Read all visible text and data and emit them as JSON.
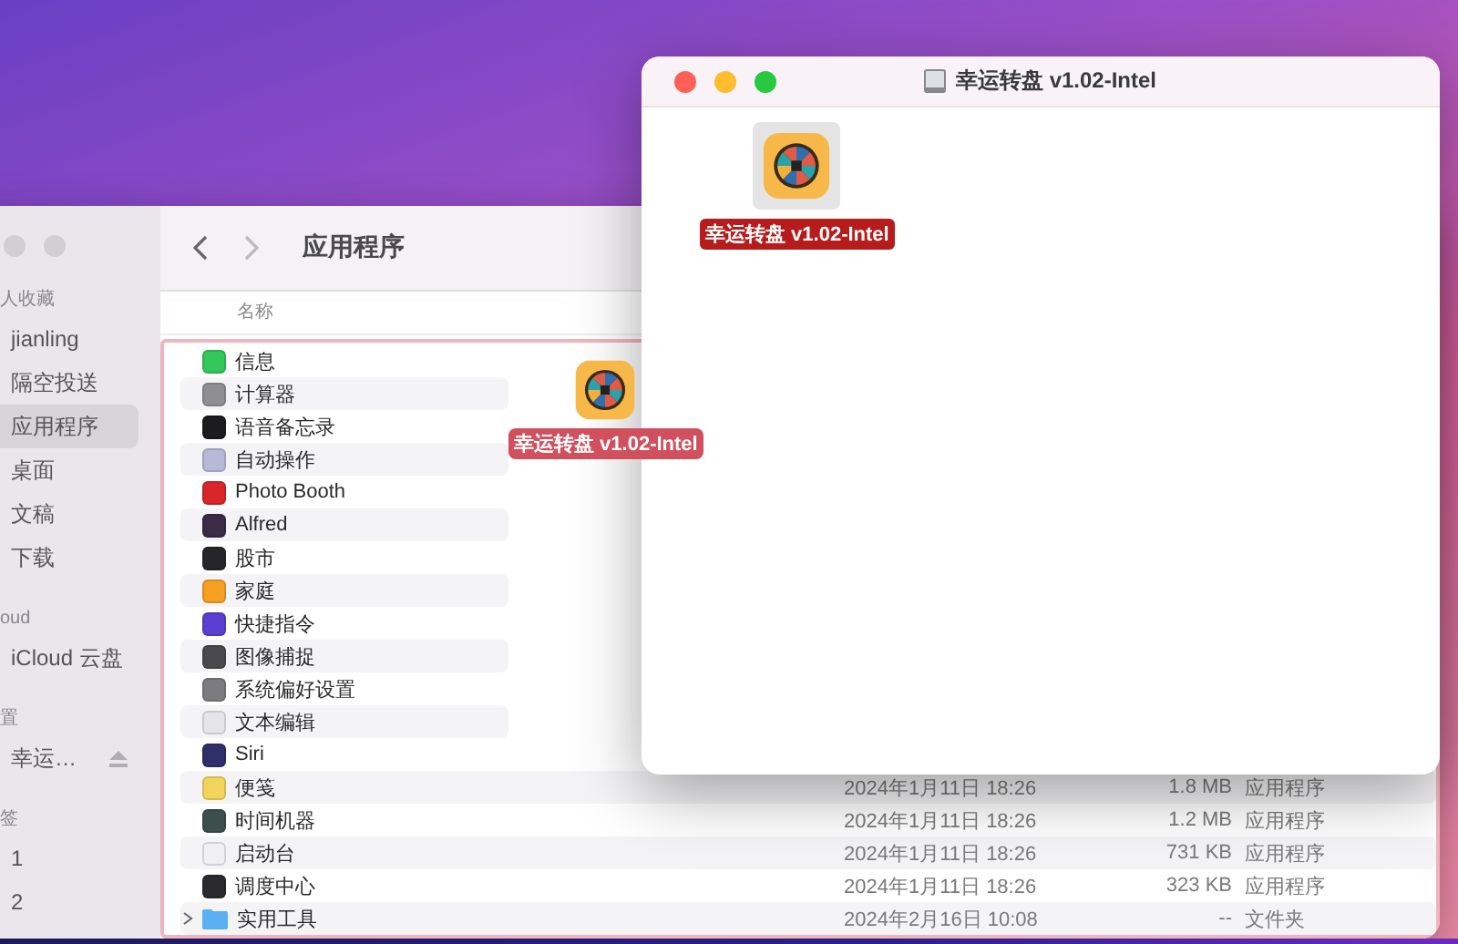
{
  "finder": {
    "title": "应用程序",
    "column_header": "名称",
    "sidebar": [
      {
        "heading": "人收藏",
        "items": [
          {
            "label": "jianling",
            "selected": false
          },
          {
            "label": "隔空投送",
            "selected": false
          },
          {
            "label": "应用程序",
            "selected": true
          },
          {
            "label": "桌面",
            "selected": false
          },
          {
            "label": "文稿",
            "selected": false
          },
          {
            "label": "下载",
            "selected": false
          }
        ]
      },
      {
        "heading": "oud",
        "items": [
          {
            "label": "iCloud 云盘",
            "selected": false
          }
        ]
      },
      {
        "heading": "置",
        "items": [
          {
            "label": "幸运…",
            "selected": false,
            "ejectable": true
          }
        ]
      },
      {
        "heading": "签",
        "items": [
          {
            "label": "1",
            "selected": false
          },
          {
            "label": "2",
            "selected": false
          }
        ]
      }
    ],
    "rows": [
      {
        "kind": "app",
        "name": "信息",
        "color": "#34c759"
      },
      {
        "kind": "app",
        "name": "计算器",
        "color": "#8e8e93"
      },
      {
        "kind": "app",
        "name": "语音备忘录",
        "color": "#1c1c1e"
      },
      {
        "kind": "app",
        "name": "自动操作",
        "color": "#b8b8d8"
      },
      {
        "kind": "app",
        "name": "Photo Booth",
        "color": "#d9262b"
      },
      {
        "kind": "app",
        "name": "Alfred",
        "color": "#3a2b46"
      },
      {
        "kind": "app",
        "name": "股市",
        "color": "#26262a"
      },
      {
        "kind": "app",
        "name": "家庭",
        "color": "#f5a023"
      },
      {
        "kind": "app",
        "name": "快捷指令",
        "color": "#5a3fd0"
      },
      {
        "kind": "app",
        "name": "图像捕捉",
        "color": "#4a4a4e"
      },
      {
        "kind": "app",
        "name": "系统偏好设置",
        "color": "#7b7b80"
      },
      {
        "kind": "app",
        "name": "文本编辑",
        "color": "#e6e6ea"
      },
      {
        "kind": "app",
        "name": "Siri",
        "color": "#2f2f6a"
      },
      {
        "kind": "app",
        "name": "便笺",
        "color": "#f2d45c",
        "date": "2024年1月11日 18:26",
        "size": "1.8 MB",
        "type": "应用程序"
      },
      {
        "kind": "app",
        "name": "时间机器",
        "color": "#3c4f4c",
        "date": "2024年1月11日 18:26",
        "size": "1.2 MB",
        "type": "应用程序"
      },
      {
        "kind": "app",
        "name": "启动台",
        "color": "#f0f0f2",
        "date": "2024年1月11日 18:26",
        "size": "731 KB",
        "type": "应用程序"
      },
      {
        "kind": "app",
        "name": "调度中心",
        "color": "#2a2a2e",
        "date": "2024年1月11日 18:26",
        "size": "323 KB",
        "type": "应用程序"
      },
      {
        "kind": "folder",
        "name": "实用工具",
        "color": "#5ab0f0",
        "date": "2024年2月16日 10:08",
        "size": "--",
        "type": "文件夹"
      }
    ]
  },
  "dragged_item": {
    "label": "幸运转盘 v1.02-Intel"
  },
  "disk_window": {
    "title": "幸运转盘 v1.02-Intel",
    "item": {
      "label": "幸运转盘 v1.02-Intel",
      "selected": true
    }
  }
}
